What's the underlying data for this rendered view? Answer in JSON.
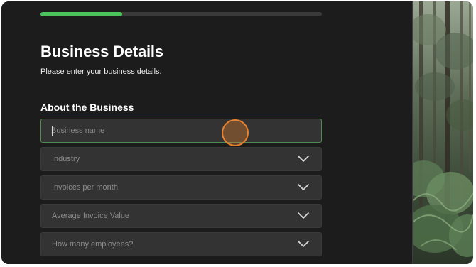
{
  "progress": {
    "value": 0.29,
    "fill_color": "#4cc35a"
  },
  "page": {
    "title": "Business Details",
    "subtitle": "Please enter your business details."
  },
  "section": {
    "title": "About the Business"
  },
  "fields": {
    "business_name": {
      "value": "",
      "placeholder": "Business name"
    },
    "industry": {
      "label": "Industry",
      "icon": "chevron-down-icon"
    },
    "invoices": {
      "label": "Invoices per month",
      "icon": "chevron-down-icon"
    },
    "avg_invoice": {
      "label": "Average Invoice Value",
      "icon": "chevron-down-icon"
    },
    "employees": {
      "label": "How many employees?",
      "icon": "chevron-down-icon"
    }
  },
  "side_image": {
    "subject": "forest"
  },
  "colors": {
    "background": "#1c1c1c",
    "field": "#333333",
    "focus_border": "#4b8d4f",
    "cursor": "#e9822f"
  }
}
